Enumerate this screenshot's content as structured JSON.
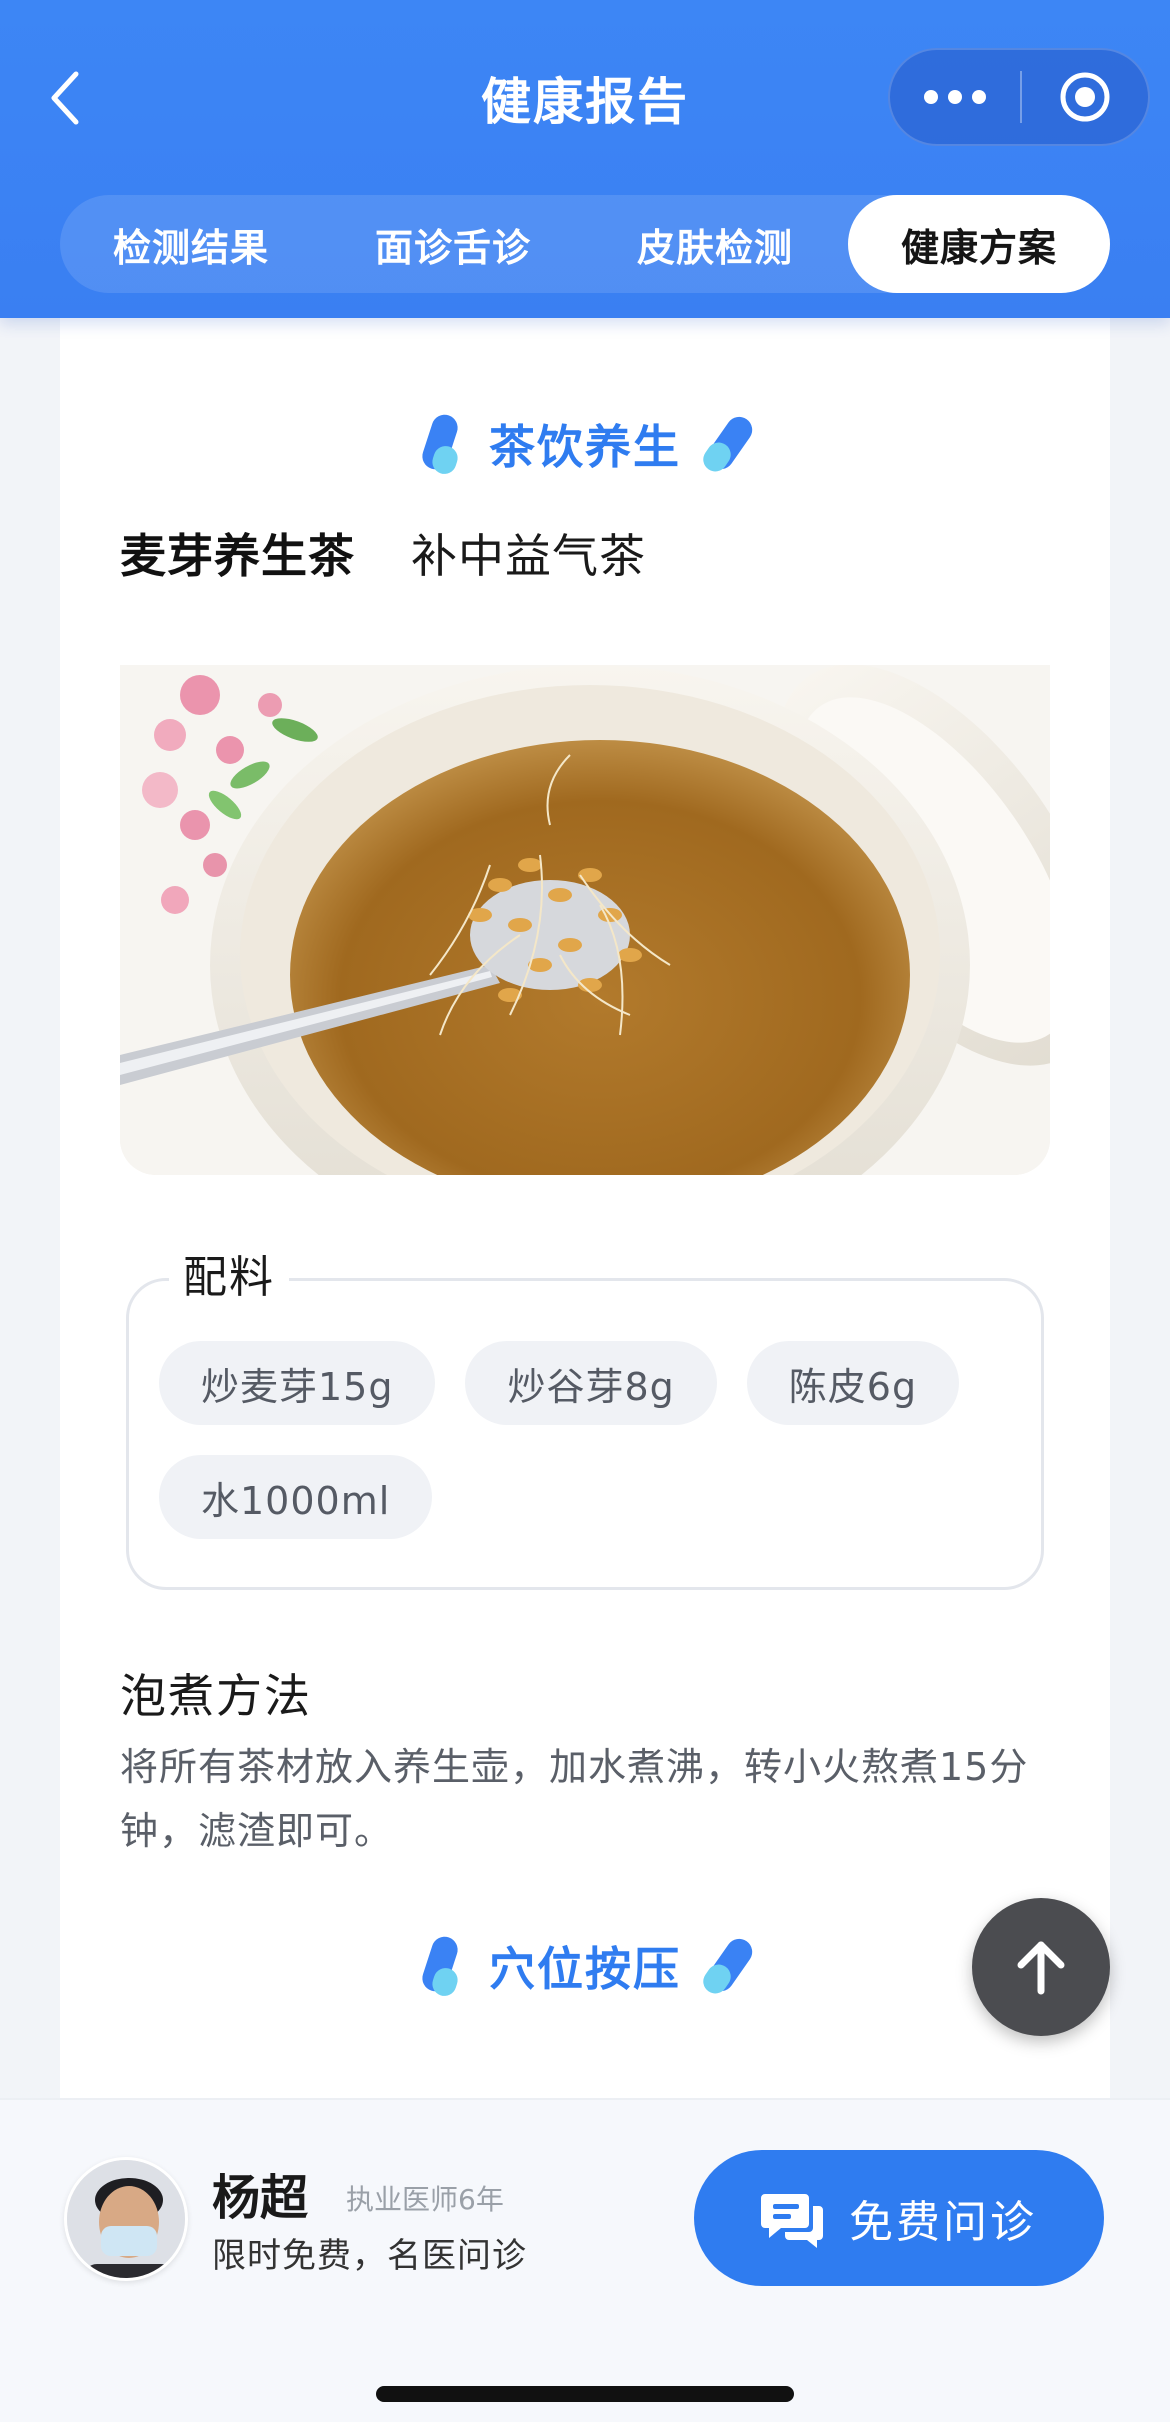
{
  "header": {
    "title": "健康报告",
    "back_icon": "chevron-left-icon",
    "more_icon": "more-dots-icon",
    "close_icon": "target-circle-icon"
  },
  "tabs": [
    {
      "label": "检测结果",
      "active": false
    },
    {
      "label": "面诊舌诊",
      "active": false
    },
    {
      "label": "皮肤检测",
      "active": false
    },
    {
      "label": "健康方案",
      "active": true
    }
  ],
  "tea_section": {
    "title": "茶饮养生",
    "tea_tabs": [
      {
        "label": "麦芽养生茶",
        "active": true
      },
      {
        "label": "补中益气茶",
        "active": false
      }
    ],
    "ingredients_title": "配料",
    "ingredients": [
      "炒麦芽15g",
      "炒谷芽8g",
      "陈皮6g",
      "水1000ml"
    ],
    "method_title": "泡煮方法",
    "method_text": "将所有茶材放入养生壶，加水煮沸，转小火熬煮15分钟，滤渣即可。"
  },
  "acupressure_section": {
    "title": "穴位按压"
  },
  "doctor": {
    "name": "杨超",
    "title": "执业医师6年",
    "subtitle": "限时免费，名医问诊",
    "button_label": "免费问诊"
  },
  "colors": {
    "primary": "#2f7cf0",
    "header_bg": "#3d86f5",
    "chip_bg": "#f0f2f6",
    "fab_bg": "#4b4c50"
  }
}
